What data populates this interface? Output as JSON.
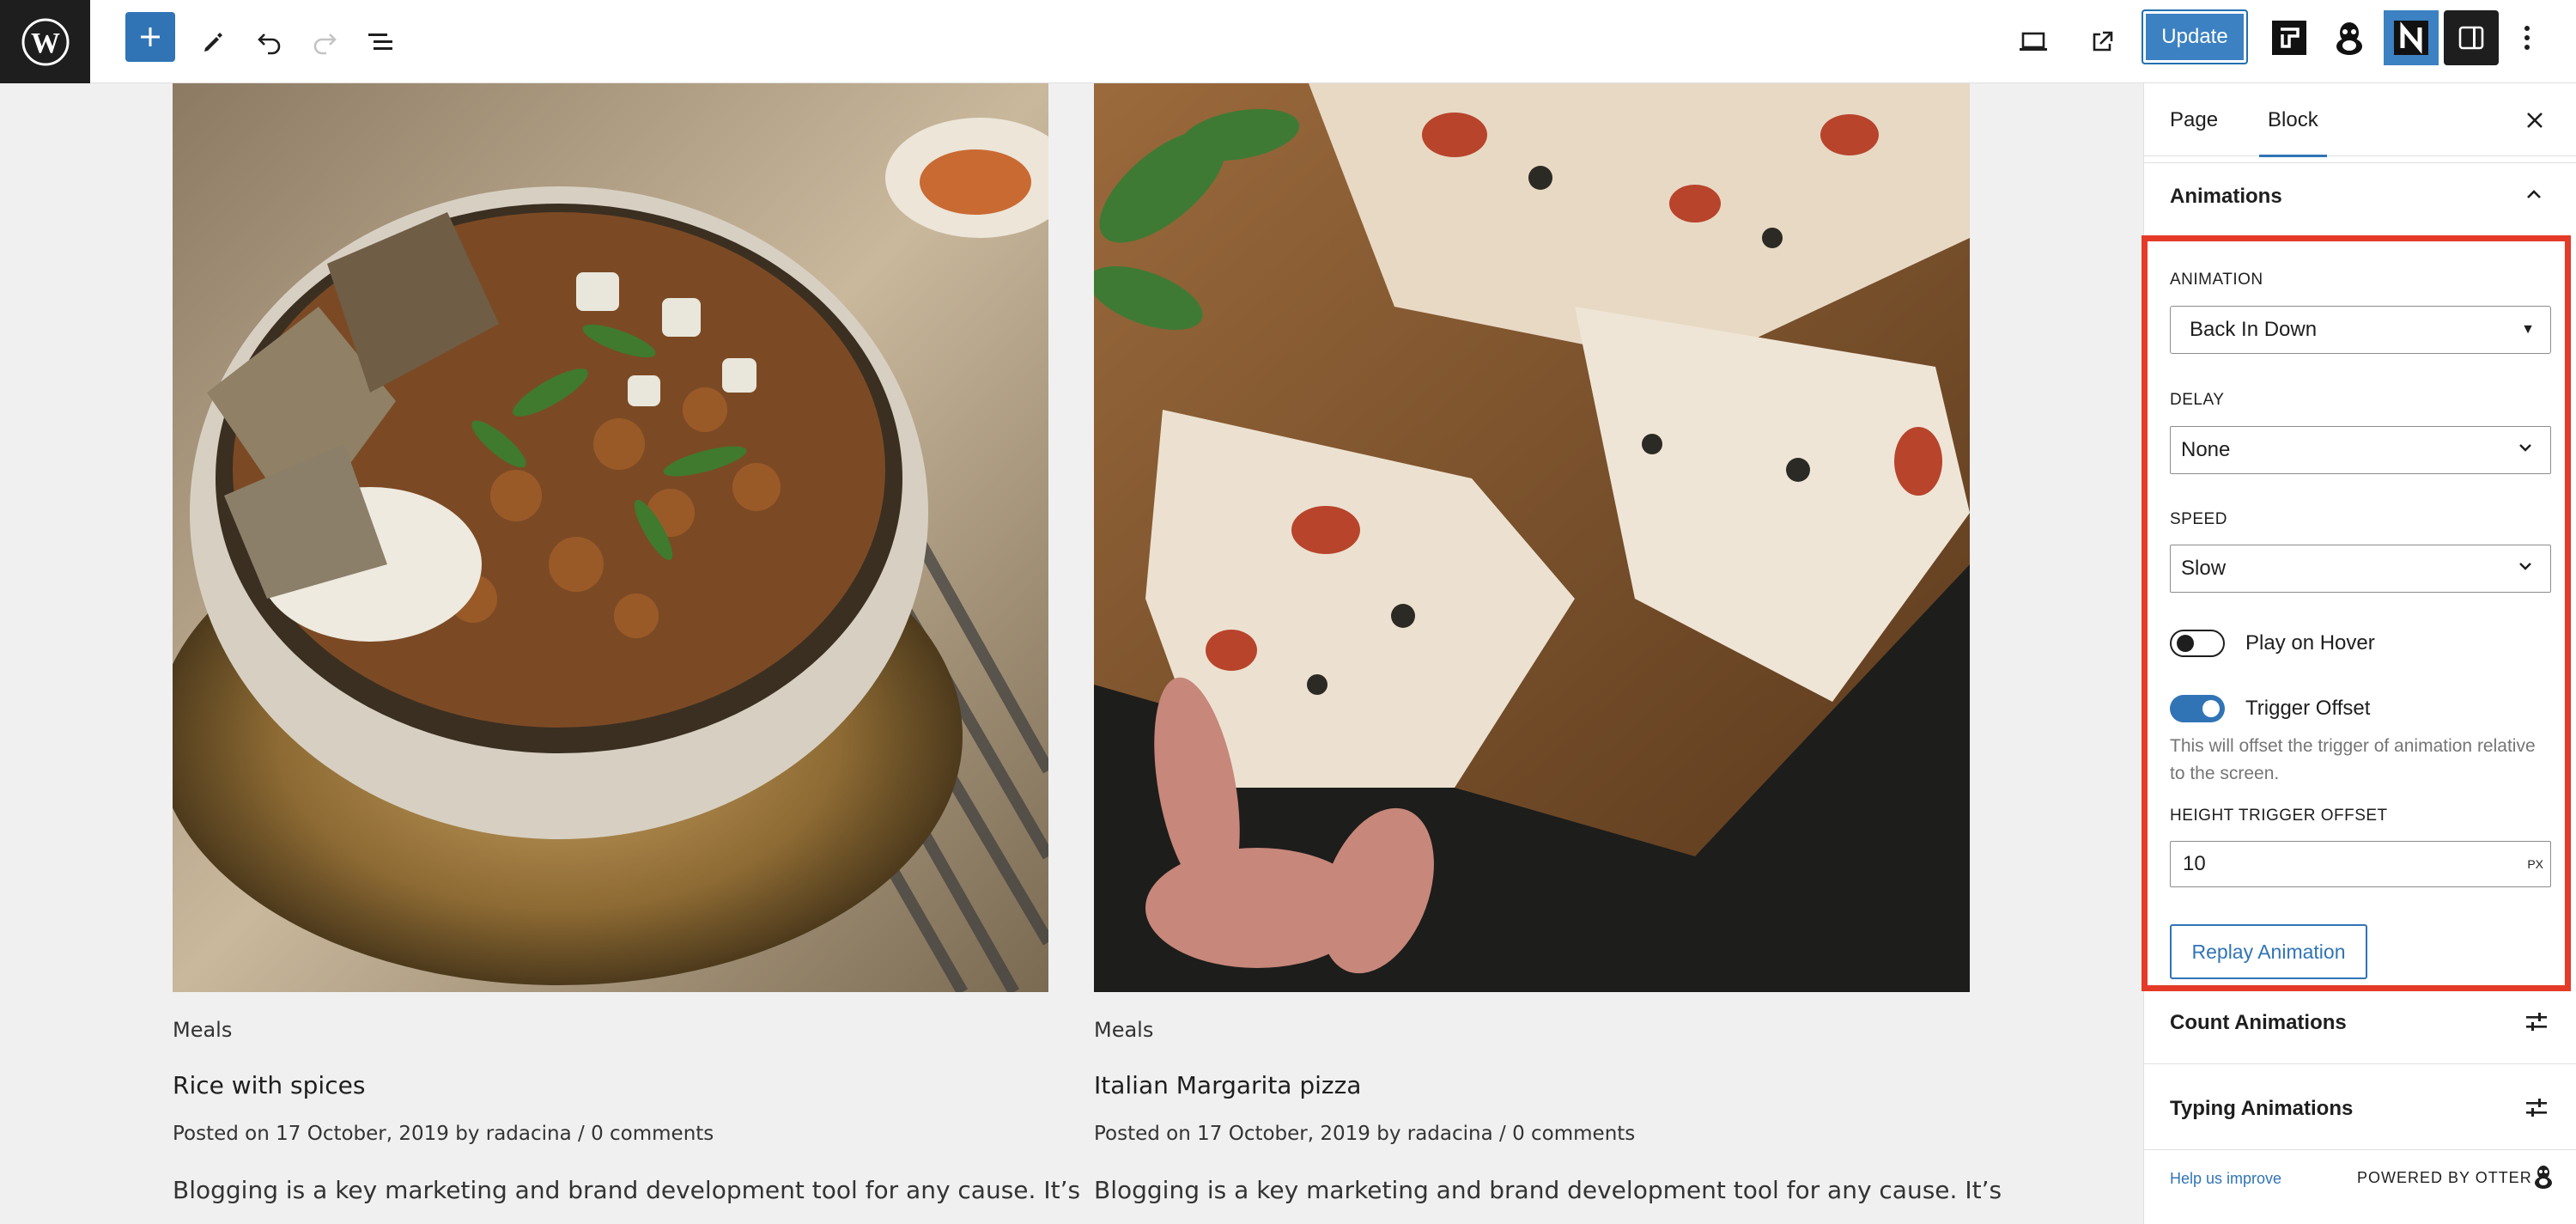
{
  "toolbar": {
    "update_label": "Update"
  },
  "posts": [
    {
      "category": "Meals",
      "title": "Rice with spices",
      "meta": "Posted on 17 October, 2019 by radacina / 0 comments",
      "excerpt": "Blogging is a key marketing and brand development tool for any cause. It’s"
    },
    {
      "category": "Meals",
      "title": "Italian Margarita pizza",
      "meta": "Posted on 17 October, 2019 by radacina / 0 comments",
      "excerpt": "Blogging is a key marketing and brand development tool for any cause. It’s"
    }
  ],
  "sidebar": {
    "tabs": [
      "Page",
      "Block"
    ],
    "active_tab": "Block",
    "panel_title": "Animations",
    "animation": {
      "label": "ANIMATION",
      "value": "Back In Down"
    },
    "delay": {
      "label": "DELAY",
      "value": "None"
    },
    "speed": {
      "label": "SPEED",
      "value": "Slow"
    },
    "play_on_hover": {
      "label": "Play on Hover",
      "enabled": false
    },
    "trigger_offset": {
      "label": "Trigger Offset",
      "enabled": true
    },
    "help_text": "This will offset the trigger of animation relative to the screen.",
    "height_offset": {
      "label": "HEIGHT TRIGGER OFFSET",
      "value": "10",
      "unit": "PX"
    },
    "replay_label": "Replay Animation",
    "count_animations": "Count Animations",
    "typing_animations": "Typing Animations",
    "help_link": "Help us improve",
    "powered_by": "POWERED BY OTTER"
  },
  "colors": {
    "accent": "#3074b6",
    "highlight": "#e53a28",
    "wp_dark": "#1e1e1e"
  }
}
